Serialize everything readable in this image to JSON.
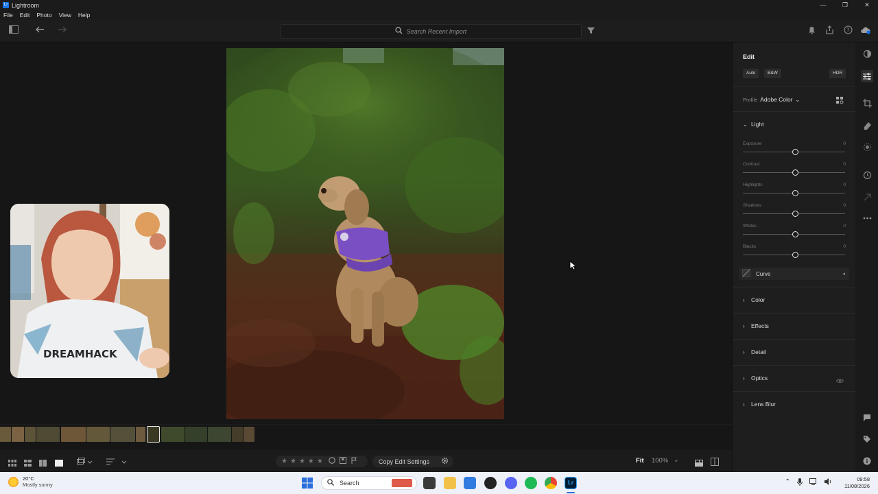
{
  "window": {
    "title": "Lightroom",
    "app_icon_text": "Lr",
    "controls": [
      "—",
      "❐",
      "✕"
    ]
  },
  "menu": [
    "File",
    "Edit",
    "Photo",
    "View",
    "Help"
  ],
  "toolbar": {
    "search_placeholder": "Search Recent Import"
  },
  "edit_panel": {
    "title": "Edit",
    "buttons": {
      "auto": "Auto",
      "bw": "B&W",
      "hdr": "HDR"
    },
    "profile_label": "Profile",
    "profile_value": "Adobe Color",
    "light": {
      "label": "Light",
      "expanded": true,
      "sliders": [
        {
          "label": "Exposure",
          "value": "0"
        },
        {
          "label": "Contrast",
          "value": "0"
        },
        {
          "label": "Highlights",
          "value": "0"
        },
        {
          "label": "Shadows",
          "value": "0"
        },
        {
          "label": "Whites",
          "value": "0"
        },
        {
          "label": "Blacks",
          "value": "0"
        }
      ],
      "curve_label": "Curve"
    },
    "sections": [
      "Color",
      "Effects",
      "Detail",
      "Optics",
      "Lens Blur"
    ]
  },
  "bottom_bar": {
    "copy_button": "Copy Edit Settings",
    "fit_label": "Fit",
    "zoom_value": "100%"
  },
  "taskbar": {
    "weather_temp": "20°C",
    "weather_desc": "Mostly sunny",
    "search_label": "Search",
    "time": "09:58",
    "date": "11/08/2026"
  },
  "webcam": {
    "shirt_text": "DREAMHACK"
  },
  "colors": {
    "accent_blue": "#1473e6",
    "harness_purple": "#7b4fc4"
  }
}
